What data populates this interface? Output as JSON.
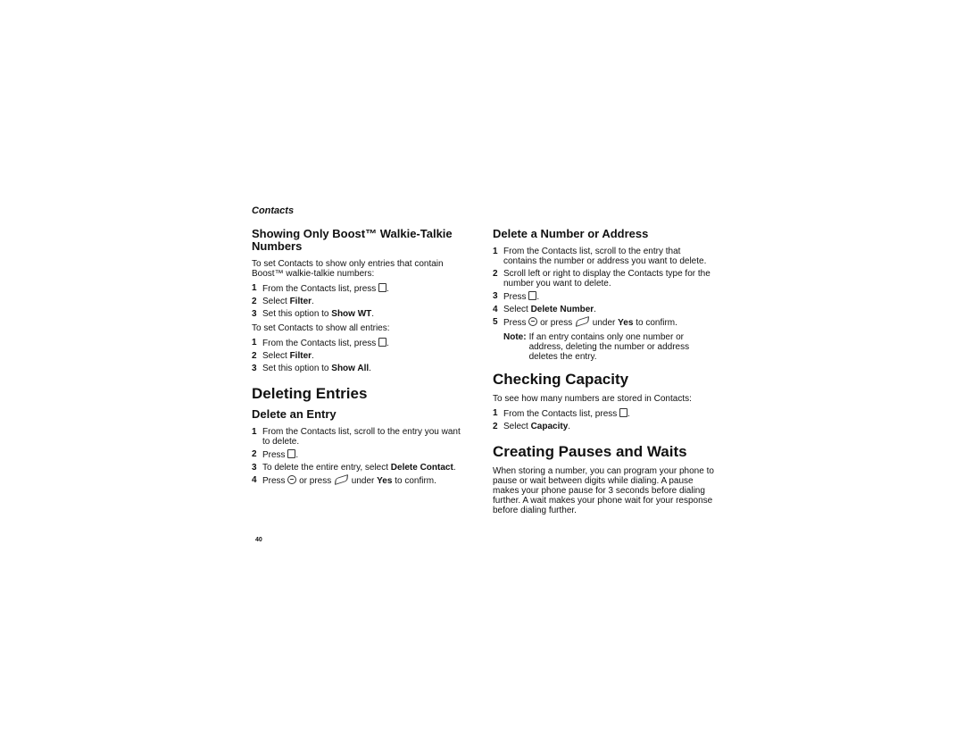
{
  "running_head": "Contacts",
  "page_number": "40",
  "left": {
    "section1": {
      "heading": "Showing Only Boost™ Walkie-Talkie Numbers",
      "intro": "To set Contacts to show only entries that contain Boost™ walkie-talkie numbers:",
      "steps_a": [
        {
          "num": "1",
          "pre": "From the Contacts list, press ",
          "icon": "menu-key-icon",
          "post": "."
        },
        {
          "num": "2",
          "pre": "Select ",
          "bold": "Filter",
          "post": "."
        },
        {
          "num": "3",
          "pre": "Set this option to ",
          "bold": "Show WT",
          "post": "."
        }
      ],
      "intro2": "To set Contacts to show all entries:",
      "steps_b": [
        {
          "num": "1",
          "pre": "From the Contacts list, press ",
          "icon": "menu-key-icon",
          "post": "."
        },
        {
          "num": "2",
          "pre": "Select ",
          "bold": "Filter",
          "post": "."
        },
        {
          "num": "3",
          "pre": "Set this option to ",
          "bold": "Show All",
          "post": "."
        }
      ]
    },
    "section2": {
      "heading": "Deleting Entries",
      "subheading": "Delete an Entry",
      "steps": [
        {
          "num": "1",
          "pre": "From the Contacts list, scroll to the entry you want to delete."
        },
        {
          "num": "2",
          "pre": "Press ",
          "icon": "menu-key-icon",
          "post": "."
        },
        {
          "num": "3",
          "pre": "To delete the entire entry, select ",
          "bold": "Delete Contact",
          "post": "."
        },
        {
          "num": "4",
          "pre": "Press ",
          "icon": "ok-key-icon",
          "mid": " or press ",
          "icon2": "softkey-icon",
          "mid2": " under ",
          "bold": "Yes",
          "post": " to confirm."
        }
      ]
    }
  },
  "right": {
    "section1": {
      "subheading": "Delete a Number or Address",
      "steps": [
        {
          "num": "1",
          "pre": "From the Contacts list, scroll to the entry that contains the number or address you want to delete."
        },
        {
          "num": "2",
          "pre": "Scroll left or right to display the Contacts type for the number you want to delete."
        },
        {
          "num": "3",
          "pre": "Press ",
          "icon": "menu-key-icon",
          "post": "."
        },
        {
          "num": "4",
          "pre": "Select ",
          "bold": "Delete Number",
          "post": "."
        },
        {
          "num": "5",
          "pre": "Press ",
          "icon": "ok-key-icon",
          "mid": " or press ",
          "icon2": "softkey-icon",
          "mid2": " under ",
          "bold": "Yes",
          "post": " to confirm."
        }
      ],
      "note_label": "Note:",
      "note_text": "If an entry contains only one number or address, deleting the number or address deletes the entry."
    },
    "section2": {
      "heading": "Checking Capacity",
      "intro": "To see how many numbers are stored in Contacts:",
      "steps": [
        {
          "num": "1",
          "pre": "From the Contacts list, press ",
          "icon": "menu-key-icon",
          "post": "."
        },
        {
          "num": "2",
          "pre": "Select ",
          "bold": "Capacity",
          "post": "."
        }
      ]
    },
    "section3": {
      "heading": "Creating Pauses and Waits",
      "body": "When storing a number, you can program your phone to pause or wait between digits while dialing. A pause makes your phone pause for 3 seconds before dialing further. A wait makes your phone wait for your response before dialing further."
    }
  }
}
